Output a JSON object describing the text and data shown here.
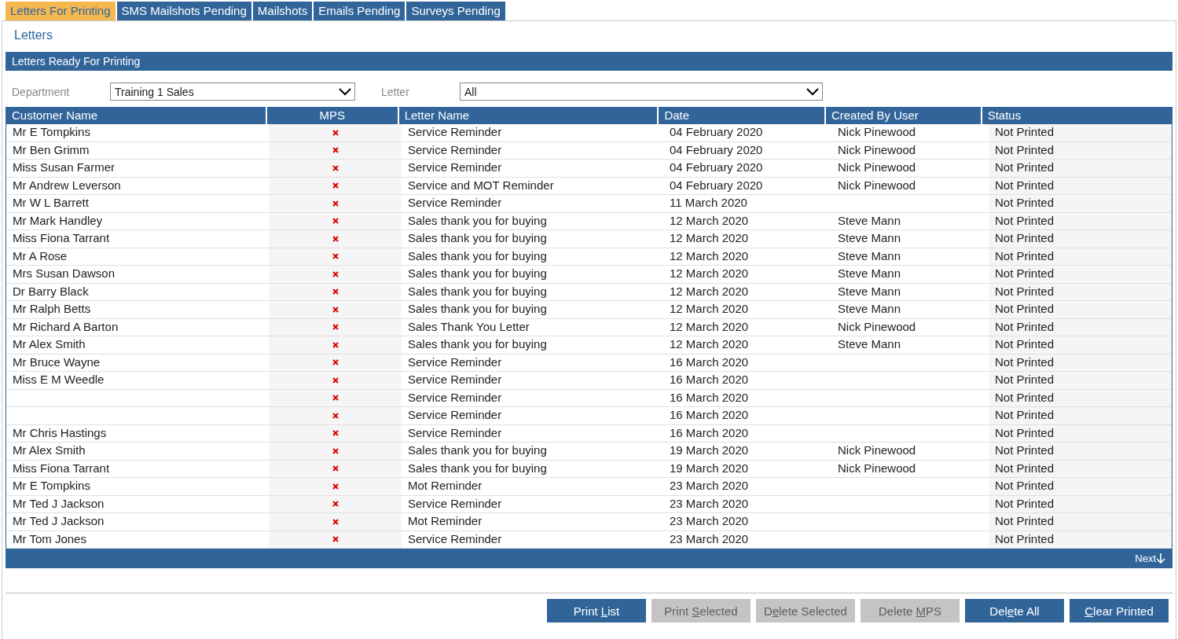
{
  "tabs": [
    {
      "label": "Letters For Printing",
      "selected": true
    },
    {
      "label": "SMS Mailshots Pending",
      "selected": false
    },
    {
      "label": "Mailshots",
      "selected": false
    },
    {
      "label": "Emails Pending",
      "selected": false
    },
    {
      "label": "Surveys Pending",
      "selected": false
    }
  ],
  "page_title": "Letters",
  "section_title": "Letters Ready For Printing",
  "filters": [
    {
      "label": "Department",
      "value": "Training 1 Sales"
    },
    {
      "label": "Letter",
      "value": "All"
    }
  ],
  "table": {
    "columns": [
      "Customer Name",
      "MPS",
      "Letter Name",
      "Date",
      "Created By User",
      "Status"
    ],
    "rows": [
      {
        "customer": "Mr E Tompkins",
        "mps": true,
        "letter": "Service Reminder",
        "date": "04 February 2020",
        "user": "Nick Pinewood",
        "status": "Not Printed"
      },
      {
        "customer": "Mr Ben Grimm",
        "mps": true,
        "letter": "Service Reminder",
        "date": "04 February 2020",
        "user": "Nick Pinewood",
        "status": "Not Printed"
      },
      {
        "customer": "Miss Susan Farmer",
        "mps": true,
        "letter": "Service Reminder",
        "date": "04 February 2020",
        "user": "Nick Pinewood",
        "status": "Not Printed"
      },
      {
        "customer": "Mr Andrew Leverson",
        "mps": true,
        "letter": "Service and MOT Reminder",
        "date": "04 February 2020",
        "user": "Nick Pinewood",
        "status": "Not Printed"
      },
      {
        "customer": "Mr W L Barrett",
        "mps": true,
        "letter": "Service Reminder",
        "date": "11 March 2020",
        "status": "Not Printed"
      },
      {
        "customer": "Mr Mark Handley",
        "mps": true,
        "letter": "Sales thank you for buying",
        "date": "12 March 2020",
        "user": "Steve Mann",
        "status": "Not Printed"
      },
      {
        "customer": "Miss Fiona Tarrant",
        "mps": true,
        "letter": "Sales thank you for buying",
        "date": "12 March 2020",
        "user": "Steve Mann",
        "status": "Not Printed"
      },
      {
        "customer": "Mr A Rose",
        "mps": true,
        "letter": "Sales thank you for buying",
        "date": "12 March 2020",
        "user": "Steve Mann",
        "status": "Not Printed"
      },
      {
        "customer": "Mrs Susan Dawson",
        "mps": true,
        "letter": "Sales thank you for buying",
        "date": "12 March 2020",
        "user": "Steve Mann",
        "status": "Not Printed"
      },
      {
        "customer": "Dr Barry Black",
        "mps": true,
        "letter": "Sales thank you for buying",
        "date": "12 March 2020",
        "user": "Steve Mann",
        "status": "Not Printed"
      },
      {
        "customer": "Mr Ralph Betts",
        "mps": true,
        "letter": "Sales thank you for buying",
        "date": "12 March 2020",
        "user": "Steve Mann",
        "status": "Not Printed"
      },
      {
        "customer": "Mr Richard A Barton",
        "mps": true,
        "letter": "Sales Thank You Letter",
        "date": "12 March 2020",
        "user": "Nick Pinewood",
        "status": "Not Printed"
      },
      {
        "customer": "Mr Alex Smith",
        "mps": true,
        "letter": "Sales thank you for buying",
        "date": "12 March 2020",
        "user": "Steve Mann",
        "status": "Not Printed"
      },
      {
        "customer": "Mr Bruce Wayne",
        "mps": true,
        "letter": "Service Reminder",
        "date": "16 March 2020",
        "status": "Not Printed"
      },
      {
        "customer": "Miss E M Weedle",
        "mps": true,
        "letter": "Service Reminder",
        "date": "16 March 2020",
        "status": "Not Printed"
      },
      {
        "mps": true,
        "letter": "Service Reminder",
        "date": "16 March 2020",
        "status": "Not Printed"
      },
      {
        "mps": true,
        "letter": "Service Reminder",
        "date": "16 March 2020",
        "status": "Not Printed"
      },
      {
        "customer": "Mr Chris Hastings",
        "mps": true,
        "letter": "Service Reminder",
        "date": "16 March 2020",
        "status": "Not Printed"
      },
      {
        "customer": "Mr Alex Smith",
        "mps": true,
        "letter": "Sales thank you for buying",
        "date": "19 March 2020",
        "user": "Nick Pinewood",
        "status": "Not Printed"
      },
      {
        "customer": "Miss Fiona Tarrant",
        "mps": true,
        "letter": "Sales thank you for buying",
        "date": "19 March 2020",
        "user": "Nick Pinewood",
        "status": "Not Printed"
      },
      {
        "customer": "Mr E Tompkins",
        "mps": true,
        "letter": "Mot Reminder",
        "date": "23 March 2020",
        "status": "Not Printed"
      },
      {
        "customer": "Mr Ted J Jackson",
        "mps": true,
        "letter": "Service Reminder",
        "date": "23 March 2020",
        "status": "Not Printed"
      },
      {
        "customer": "Mr Ted J Jackson",
        "mps": true,
        "letter": "Mot Reminder",
        "date": "23 March 2020",
        "status": "Not Printed"
      },
      {
        "customer": "Mr Tom Jones",
        "mps": true,
        "letter": "Service Reminder",
        "date": "23 March 2020",
        "status": "Not Printed"
      }
    ],
    "next_link": "Next"
  },
  "buttons": [
    {
      "before": "Print ",
      "key": "L",
      "after": "ist",
      "disabled": false
    },
    {
      "before": "Print ",
      "key": "S",
      "after": "elected",
      "disabled": true
    },
    {
      "before": "D",
      "key": "e",
      "after": "lete Selected",
      "disabled": true
    },
    {
      "before": "Delete ",
      "key": "M",
      "after": "PS",
      "disabled": true
    },
    {
      "before": "Del",
      "key": "e",
      "after": "te All",
      "disabled": false
    },
    {
      "key": "C",
      "after": "lear Printed",
      "disabled": false
    }
  ]
}
